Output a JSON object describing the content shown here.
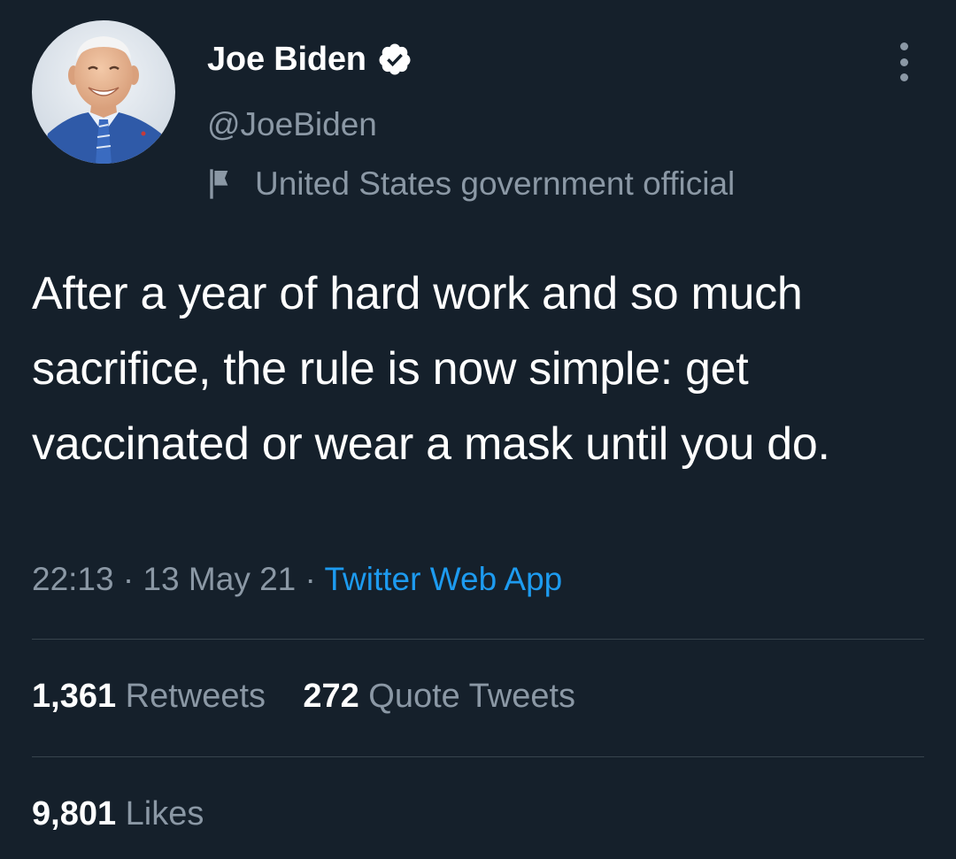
{
  "author": {
    "name": "Joe Biden",
    "handle": "@JoeBiden",
    "label": "United States government official",
    "verified": true
  },
  "tweet": {
    "text": "After a year of hard work and so much sacrifice, the rule is now simple: get vaccinated or wear a mask until you do.",
    "time": "22:13",
    "date": "13 May 21",
    "separator": "·",
    "source": "Twitter Web App"
  },
  "stats": {
    "retweets_count": "1,361",
    "retweets_label": "Retweets",
    "quotes_count": "272",
    "quotes_label": "Quote Tweets",
    "likes_count": "9,801",
    "likes_label": "Likes"
  },
  "icons": {
    "verified": "verified-badge-icon",
    "flag": "flag-icon",
    "more": "more-options-icon"
  },
  "colors": {
    "background": "#15202b",
    "text_primary": "#ffffff",
    "text_secondary": "#8b98a5",
    "link": "#1d9bf0",
    "divider": "#38444d"
  }
}
